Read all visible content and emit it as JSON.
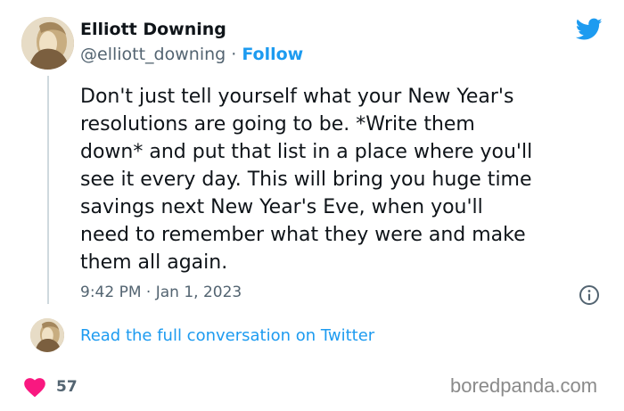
{
  "author": {
    "name": "Elliott Downing",
    "handle": "@elliott_downing",
    "separator": " · ",
    "follow_label": "Follow"
  },
  "tweet": {
    "text": "Don't just tell yourself what your New Year's\nresolutions are going to be. *Write them\ndown* and put that list in a place where you'll\nsee it every day. This will bring you huge time\nsavings next New Year's Eve, when you'll\nneed to remember what they were and make\nthem all again.",
    "timestamp": "9:42 PM · Jan 1, 2023"
  },
  "conversation_link": "Read the full conversation on Twitter",
  "likes": {
    "count": "57"
  },
  "watermark": "boredpanda.com",
  "icons": {
    "logo": "twitter-bird-icon",
    "info": "info-icon",
    "like": "heart-icon"
  },
  "colors": {
    "accent": "#1d9bf0",
    "like": "#f91880",
    "text": "#0f1419",
    "secondary": "#536471"
  }
}
